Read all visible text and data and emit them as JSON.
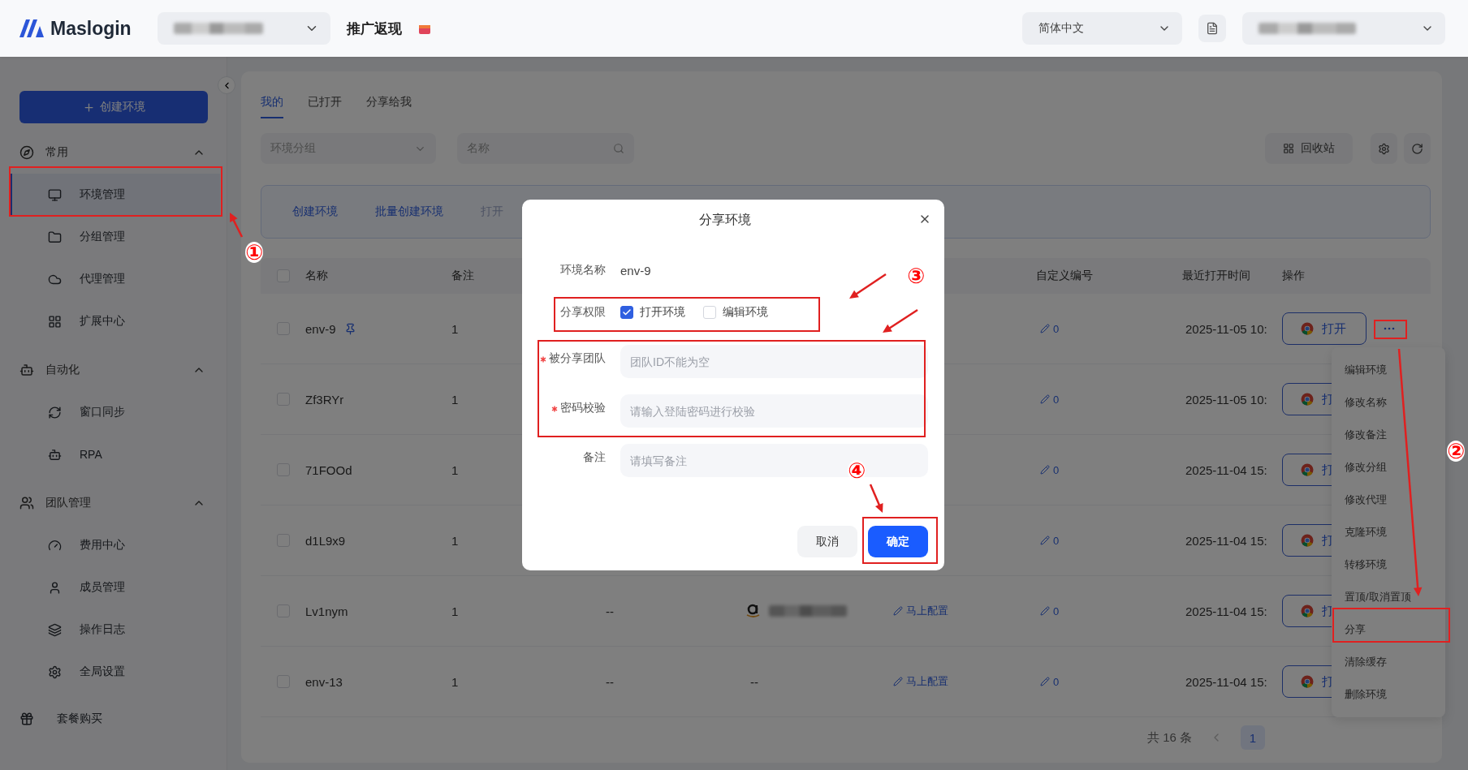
{
  "header": {
    "logo": "Maslogin",
    "promo": "推广返现",
    "language": "简体中文"
  },
  "sidebar": {
    "create_button": "创建环境",
    "sections": [
      {
        "title": "常用",
        "expanded": true,
        "items": [
          {
            "label": "环境管理",
            "selected": true
          },
          {
            "label": "分组管理",
            "selected": false
          },
          {
            "label": "代理管理",
            "selected": false
          },
          {
            "label": "扩展中心",
            "selected": false
          }
        ]
      },
      {
        "title": "自动化",
        "expanded": true,
        "items": [
          {
            "label": "窗口同步",
            "selected": false
          },
          {
            "label": "RPA",
            "selected": false
          }
        ]
      },
      {
        "title": "团队管理",
        "expanded": true,
        "items": [
          {
            "label": "费用中心",
            "selected": false
          },
          {
            "label": "成员管理",
            "selected": false
          },
          {
            "label": "操作日志",
            "selected": false
          },
          {
            "label": "全局设置",
            "selected": false
          }
        ]
      }
    ],
    "footer_item": "套餐购买"
  },
  "tabs": [
    {
      "label": "我的",
      "selected": true
    },
    {
      "label": "已打开",
      "selected": false
    },
    {
      "label": "分享给我",
      "selected": false
    }
  ],
  "filters": {
    "group_placeholder": "环境分组",
    "search_placeholder": "名称",
    "recycle_button": "回收站"
  },
  "actions": [
    "创建环境",
    "批量创建环境",
    "打开"
  ],
  "table": {
    "select_all_checked": false,
    "columns": [
      "名称",
      "备注",
      "自定义编号",
      "最近打开时间",
      "操作"
    ],
    "rows": [
      {
        "name": "env-9",
        "pinned": true,
        "checked": false,
        "note": "1",
        "custom_id": "0",
        "last_opened": "2025-11-05 10:",
        "open_label": "打开"
      },
      {
        "name": "Zf3RYr",
        "pinned": false,
        "checked": false,
        "note": "1",
        "custom_id": "0",
        "last_opened": "2025-11-05 10:",
        "open_label": "打"
      },
      {
        "name": "71FOOd",
        "pinned": false,
        "checked": false,
        "note": "1",
        "custom_id": "0",
        "last_opened": "2025-11-04 15:",
        "open_label": "打"
      },
      {
        "name": "d1L9x9",
        "pinned": false,
        "checked": false,
        "note": "1",
        "custom_id": "0",
        "last_opened": "2025-11-04 15:",
        "open_label": "打"
      },
      {
        "name": "Lv1nym",
        "pinned": false,
        "checked": false,
        "note": "1",
        "column_3": "--",
        "proxy": {
          "kind": "logo"
        },
        "config": "马上配置",
        "custom_id": "0",
        "last_opened": "2025-11-04 15:",
        "open_label": "打"
      },
      {
        "name": "env-13",
        "pinned": false,
        "checked": false,
        "note": "1",
        "column_3": "--",
        "proxy": {
          "kind": "text",
          "text": "--"
        },
        "config": "马上配置",
        "custom_id": "0",
        "last_opened": "2025-11-04 15:",
        "open_label": "打"
      }
    ],
    "pagination": {
      "total": "共 16 条",
      "pages": [
        {
          "label": "1",
          "selected": true
        }
      ]
    }
  },
  "row_menu": [
    "编辑环境",
    "修改名称",
    "修改备注",
    "修改分组",
    "修改代理",
    "克隆环境",
    "转移环境",
    "置顶/取消置顶",
    "分享",
    "清除缓存",
    "删除环境"
  ],
  "modal": {
    "title": "分享环境",
    "fields": [
      {
        "kind": "text",
        "label": "环境名称",
        "value": "env-9"
      },
      {
        "kind": "checkboxes",
        "label": "分享权限",
        "options": [
          {
            "label": "打开环境",
            "checked": true
          },
          {
            "label": "编辑环境",
            "checked": false
          }
        ]
      },
      {
        "kind": "input",
        "label": "被分享团队",
        "required": true,
        "placeholder": "团队ID不能为空"
      },
      {
        "kind": "input",
        "label": "密码校验",
        "required": true,
        "placeholder": "请输入登陆密码进行校验"
      },
      {
        "kind": "input",
        "label": "备注",
        "required": false,
        "placeholder": "请填写备注"
      }
    ],
    "buttons": [
      {
        "label": "取消",
        "primary": false
      },
      {
        "label": "确定",
        "primary": true
      }
    ]
  },
  "annotations": [
    {
      "label": "①"
    },
    {
      "label": "②"
    },
    {
      "label": "③"
    },
    {
      "label": "④"
    }
  ]
}
